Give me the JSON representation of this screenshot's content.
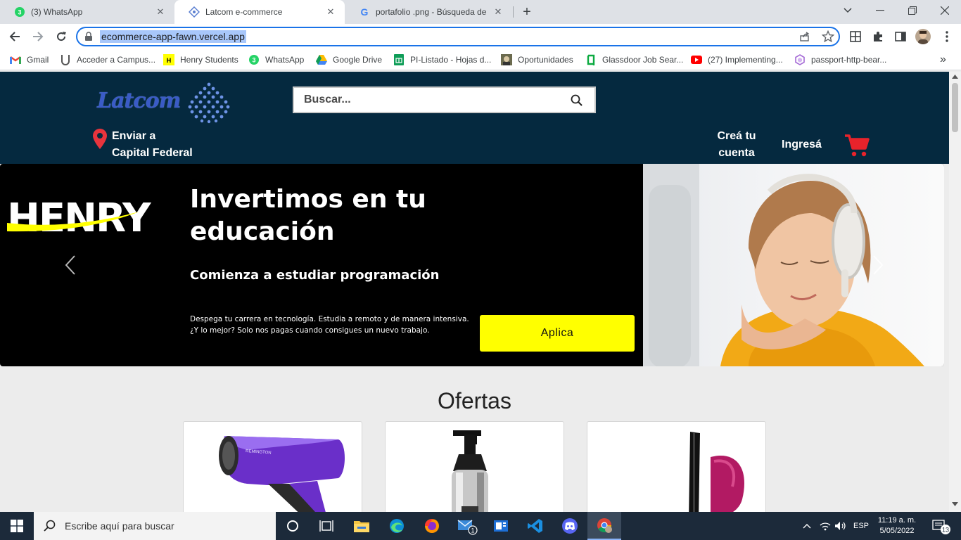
{
  "browser": {
    "tabs": [
      {
        "title": "(3) WhatsApp",
        "badge": "3"
      },
      {
        "title": "Latcom e-commerce"
      },
      {
        "title": "portafolio .png - Búsqueda de Go"
      }
    ],
    "new_tab": "+",
    "url": "ecommerce-app-fawn.vercel.app",
    "bookmarks": [
      {
        "label": "Gmail"
      },
      {
        "label": "Acceder a Campus..."
      },
      {
        "label": "Henry Students"
      },
      {
        "label": "WhatsApp"
      },
      {
        "label": "Google Drive"
      },
      {
        "label": "PI-Listado - Hojas d..."
      },
      {
        "label": "Oportunidades"
      },
      {
        "label": "Glassdoor Job Sear..."
      },
      {
        "label": "(27) Implementing..."
      },
      {
        "label": "passport-http-bear..."
      }
    ],
    "bookmarks_overflow": "»"
  },
  "site": {
    "logo_text": "Latcom",
    "search_placeholder": "Buscar...",
    "ship_line1": "Enviar a",
    "ship_line2": "Capital Federal",
    "create_line1": "Creá tu",
    "create_line2": "cuenta",
    "login": "Ingresá",
    "accent": "#05293f",
    "cart_color": "#e8232b"
  },
  "banner": {
    "brand": "HENRY",
    "headline_line1": "Invertimos en tu",
    "headline_line2": "educación",
    "subheadline": "Comienza a estudiar programación",
    "body_line1": "Despega tu carrera en tecnología. Estudia a remoto y de manera intensiva.",
    "body_line2": "¿Y lo mejor? Solo nos pagas cuando consigues un nuevo trabajo.",
    "cta": "Aplica",
    "cta_color": "#ffff00"
  },
  "ofertas": {
    "title": "Ofertas",
    "hairdryer_brand": "REMINGTON"
  },
  "taskbar": {
    "search_placeholder": "Escribe aquí para buscar",
    "mail_badge": "1",
    "language": "ESP",
    "time": "11:19 a. m.",
    "date": "5/05/2022",
    "notifications": "13"
  }
}
